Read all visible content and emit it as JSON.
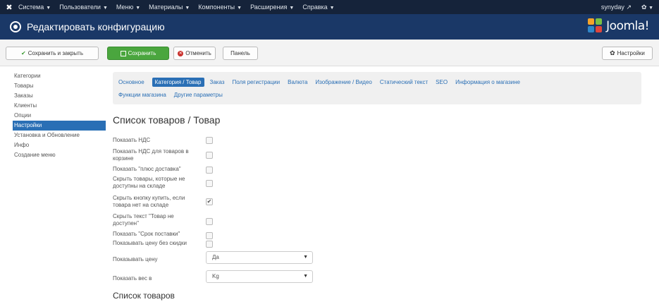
{
  "topbar": {
    "menu": [
      "Система",
      "Пользователи",
      "Меню",
      "Материалы",
      "Компоненты",
      "Расширения",
      "Справка"
    ],
    "user": "synyday"
  },
  "header": {
    "title": "Редактировать конфигурацию",
    "brand": "Joomla!"
  },
  "toolbar": {
    "save_close": "Сохранить и закрыть",
    "save": "Сохранить",
    "cancel": "Отменить",
    "panel": "Панель",
    "settings": "Настройки"
  },
  "sidebar": {
    "items": [
      {
        "label": "Категории"
      },
      {
        "label": "Товары"
      },
      {
        "label": "Заказы"
      },
      {
        "label": "Клиенты"
      },
      {
        "label": "Опции"
      },
      {
        "label": "Настройки",
        "active": true
      },
      {
        "label": "Установка и Обновление"
      },
      {
        "label": "Инфо"
      },
      {
        "label": "Создание меню"
      }
    ]
  },
  "tabs": {
    "row1": [
      "Основное",
      "Категория / Товар",
      "Заказ",
      "Поля регистрации",
      "Валюта",
      "Изображение / Видео",
      "Статический текст",
      "SEO",
      "Информация о магазине"
    ],
    "row2": [
      "Функции магазина",
      "Другие параметры"
    ],
    "active": "Категория / Товар"
  },
  "section1_title": "Список товаров / Товар",
  "section2_title": "Список товаров",
  "fields": [
    {
      "label": "Показать НДС",
      "checked": false
    },
    {
      "label": "Показать НДС для товаров в корзине",
      "checked": false
    },
    {
      "label": "Показать \"плюс доставка\"",
      "checked": false
    },
    {
      "label": "Скрыть товары, которые не доступны на складе",
      "checked": false
    },
    {
      "label": "Скрыть кнопку купить, если товара нет на складе",
      "checked": true
    },
    {
      "label": "Скрыть текст \"Товар не доступен\"",
      "checked": false
    },
    {
      "label": "Показать \"Срок поставки\"",
      "checked": false
    },
    {
      "label": "Показывать цену без скидки",
      "checked": false
    }
  ],
  "selects": [
    {
      "label": "Показывать цену",
      "value": "Да"
    },
    {
      "label": "Показать вес в",
      "value": "Kg"
    }
  ],
  "check_mark": "✔",
  "select_arrow": "▼"
}
